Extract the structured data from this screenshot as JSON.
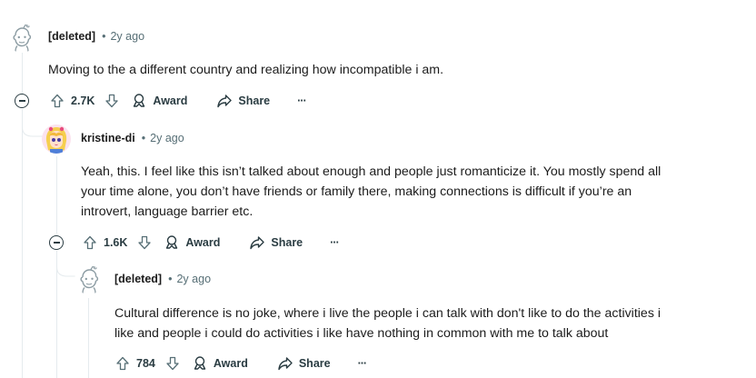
{
  "comments": [
    {
      "author": "[deleted]",
      "time": "2y ago",
      "separator": "•",
      "body": "Moving to the a different country and realizing how incompatible i am.",
      "votes": "2.7K",
      "award_label": "Award",
      "share_label": "Share",
      "more_label": "···"
    },
    {
      "author": "kristine-di",
      "time": "2y ago",
      "separator": "•",
      "body": "Yeah, this. I feel like this isn’t talked about enough and people just romanticize it. You mostly spend all\nyour time alone, you don’t have friends or family there, making connections is difficult if you’re an\nintrovert, language barrier etc.",
      "votes": "1.6K",
      "award_label": "Award",
      "share_label": "Share",
      "more_label": "···"
    },
    {
      "author": "[deleted]",
      "time": "2y ago",
      "separator": "•",
      "body": "Cultural difference is no joke, where i live the people i can talk with don't like to do the activities i\nlike and people i could do activities i like have nothing in common with me to talk about",
      "votes": "784",
      "award_label": "Award",
      "share_label": "Share",
      "more_label": "···"
    }
  ],
  "colors": {
    "text": "#1c1c1c",
    "meta": "#576f76",
    "thread_line": "#e5ebee"
  },
  "icons": [
    "deleted-user-avatar-icon",
    "user-avatar",
    "upvote-icon",
    "downvote-icon",
    "award-icon",
    "share-icon",
    "collapse-icon"
  ]
}
